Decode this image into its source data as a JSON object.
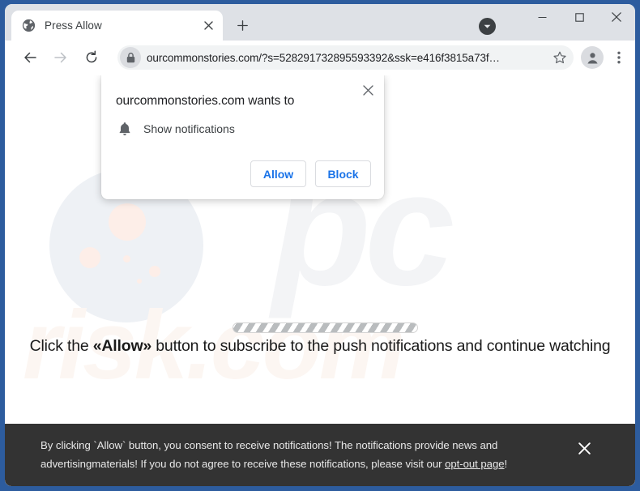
{
  "window": {
    "controls": {
      "minimize": "minimize-icon",
      "maximize": "maximize-icon",
      "close": "close-icon"
    }
  },
  "tab_strip": {
    "tabs": [
      {
        "title": "Press Allow",
        "favicon": "globe-icon",
        "close": "close-icon",
        "active": true
      }
    ],
    "new_tab_label": "+",
    "tab_search": "chevron-down-icon"
  },
  "toolbar": {
    "back": "back-arrow-icon",
    "forward": "forward-arrow-icon",
    "reload": "reload-icon",
    "lock": "lock-icon",
    "url": "ourcommonstories.com/?s=528291732895593392&ssk=e416f3815a73f…",
    "bookmark": "star-icon",
    "profile": "avatar-icon",
    "menu": "three-dot-menu-icon"
  },
  "permission_dialog": {
    "title": "ourcommonstories.com wants to",
    "permission_icon": "bell-icon",
    "permission_label": "Show notifications",
    "allow_label": "Allow",
    "block_label": "Block",
    "close": "close-icon"
  },
  "page": {
    "cta_prefix": "Click the ",
    "cta_bold": "«Allow»",
    "cta_suffix": " button to subscribe to the push notifications and continue watching",
    "watermark_pc": "pc",
    "watermark_risk": "risk.com",
    "progress": "striped-progress-bar"
  },
  "consent_banner": {
    "line1": "By clicking `Allow` button, you consent to receive notifications! The notifications provide news and advertising",
    "line2_prefix": "materials! If you do not agree to receive these notifications, please visit our ",
    "link_label": "opt-out page",
    "line2_suffix": "!",
    "close": "close-icon"
  },
  "colors": {
    "window_border": "#2d5c9e",
    "chrome_bg": "#dee1e6",
    "omnibox_bg": "#f1f3f4",
    "accent_blue": "#1a73e8",
    "banner_bg": "#333333"
  }
}
